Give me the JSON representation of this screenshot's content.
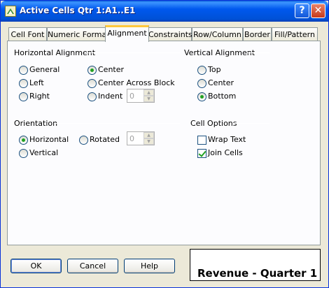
{
  "window": {
    "title": "Active Cells  Qtr 1:A1..E1",
    "help_glyph": "?",
    "close_glyph": "✕"
  },
  "tabs": [
    {
      "label": "Cell Font"
    },
    {
      "label": "Numeric Format"
    },
    {
      "label": "Alignment"
    },
    {
      "label": "Constraints"
    },
    {
      "label": "Row/Column"
    },
    {
      "label": "Border"
    },
    {
      "label": "Fill/Pattern"
    }
  ],
  "active_tab": "Alignment",
  "horizontal_alignment": {
    "label": "Horizontal Alignment",
    "options": [
      "General",
      "Left",
      "Right",
      "Center",
      "Center Across Block",
      "Indent"
    ],
    "selected": "Center",
    "indent_value": "0"
  },
  "vertical_alignment": {
    "label": "Vertical Alignment",
    "options": [
      "Top",
      "Center",
      "Bottom"
    ],
    "selected": "Bottom"
  },
  "orientation": {
    "label": "Orientation",
    "options": [
      "Horizontal",
      "Vertical",
      "Rotated"
    ],
    "selected": "Horizontal",
    "rotated_value": "0"
  },
  "cell_options": {
    "label": "Cell Options",
    "wrap_text": {
      "label": "Wrap Text",
      "checked": false
    },
    "join_cells": {
      "label": "Join Cells",
      "checked": true
    }
  },
  "buttons": {
    "ok": "OK",
    "cancel": "Cancel",
    "help": "Help"
  },
  "preview_text": "Revenue - Quarter 1",
  "colors": {
    "titlebar": "#0058ee",
    "active_tab_accent": "#ffc83c",
    "radio_dot": "#21a121"
  }
}
